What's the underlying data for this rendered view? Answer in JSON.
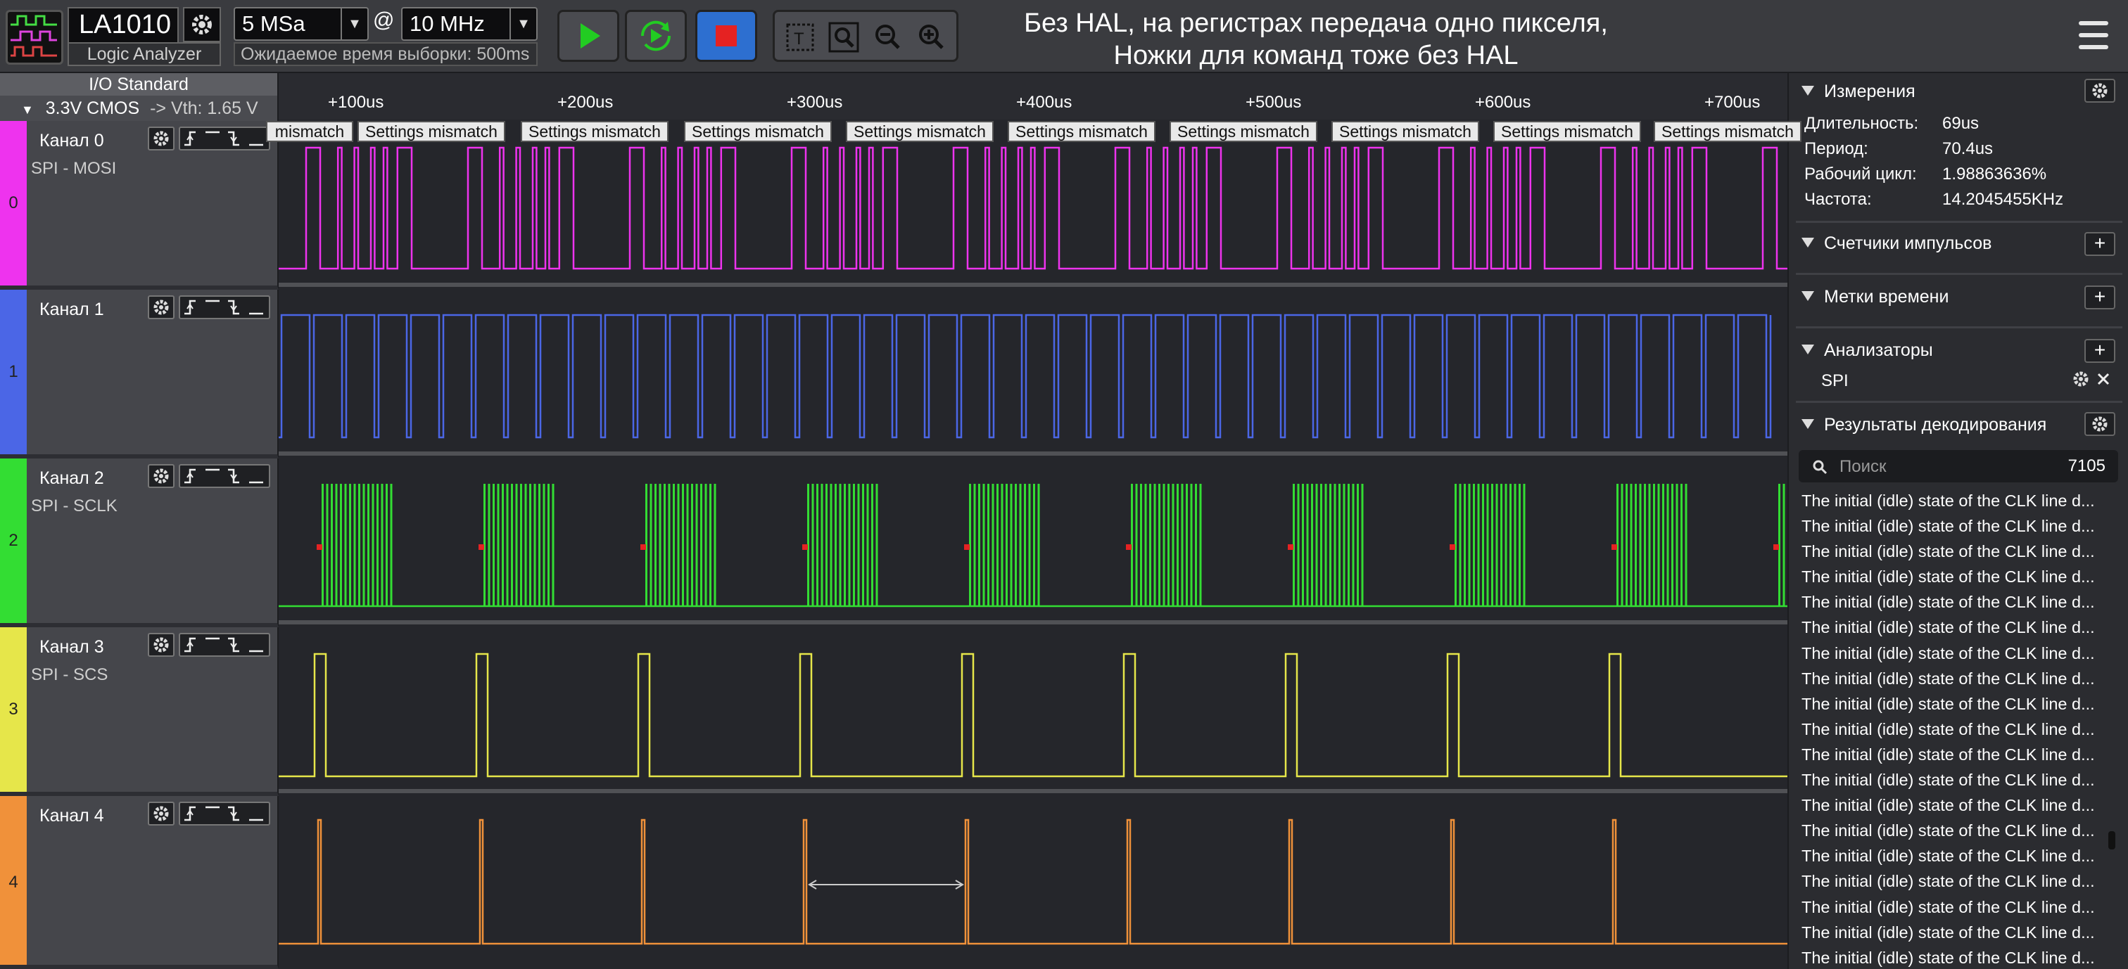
{
  "app": {
    "name": "LA1010",
    "subtitle": "Logic Analyzer"
  },
  "toolbar": {
    "sample_rate": "5 MSa",
    "at": "@",
    "frequency": "10 MHz",
    "expected_time": "Ожидаемое время выборки: 500ms",
    "icons": [
      "play-icon",
      "loop-icon",
      "stop-icon",
      "text-cursor-icon",
      "search-icon",
      "zoom-out-icon",
      "zoom-in-icon",
      "hamburger-menu-icon"
    ]
  },
  "session_title": {
    "line1": "Без HAL, на регистрах передача одно пикселя,",
    "line2": "Ножки для команд тоже без HAL"
  },
  "io": {
    "title": "I/O Standard",
    "standard": "3.3V CMOS",
    "threshold": "-> Vth: 1.65 V"
  },
  "ruler": {
    "ticks": [
      "+100us",
      "+200us",
      "+300us",
      "+400us",
      "+500us",
      "+600us",
      "+700us"
    ]
  },
  "annotation_text": "Settings mismatch",
  "annotation_first": "mismatch",
  "channels": [
    {
      "num": "0",
      "name": "Канал 0",
      "desc": "SPI - MOSI",
      "color": "#ee33ee"
    },
    {
      "num": "1",
      "name": "Канал 1",
      "desc": "",
      "color": "#4b66e6"
    },
    {
      "num": "2",
      "name": "Канал 2",
      "desc": "SPI - SCLK",
      "color": "#33dd33"
    },
    {
      "num": "3",
      "name": "Канал 3",
      "desc": "SPI - SCS",
      "color": "#e6e64a"
    },
    {
      "num": "4",
      "name": "Канал 4",
      "desc": "",
      "color": "#f0913a"
    }
  ],
  "right": {
    "measurements": {
      "title": "Измерения",
      "rows": [
        {
          "label": "Длительность:",
          "value": "69us"
        },
        {
          "label": "Период:",
          "value": "70.4us"
        },
        {
          "label": "Рабочий цикл:",
          "value": "1.98863636%"
        },
        {
          "label": "Частота:",
          "value": "14.2045455KHz"
        }
      ]
    },
    "counters_title": "Счетчики импульсов",
    "timestamps_title": "Метки времени",
    "analyzers_title": "Анализаторы",
    "analyzer_item": "SPI",
    "decoding_title": "Результаты декодирования",
    "search_placeholder": "Поиск",
    "result_count": "7105",
    "result_text": "The initial (idle) state of the CLK line d..."
  }
}
